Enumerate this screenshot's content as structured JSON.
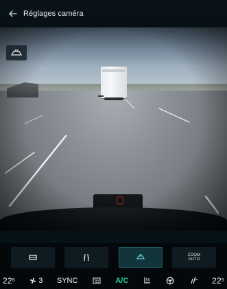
{
  "header": {
    "title": "Réglages caméra"
  },
  "controls": [
    {
      "name": "top-view",
      "icon": "car-top-view-icon"
    },
    {
      "name": "guidelines",
      "icon": "trajectory-lines-icon"
    },
    {
      "name": "rear-camera",
      "icon": "rear-camera-icon",
      "active": true
    },
    {
      "name": "zoom-auto",
      "label_top": "ZOOM",
      "label_bottom": "AUTO"
    }
  ],
  "climate": {
    "left_temp": "22",
    "left_temp_frac": "5",
    "fan_level": "3",
    "sync_label": "SYNC",
    "ac_label": "A/C",
    "right_temp": "22",
    "right_temp_frac": "5"
  },
  "colors": {
    "accent": "#22d3a0",
    "active_bg": "#12353b"
  }
}
